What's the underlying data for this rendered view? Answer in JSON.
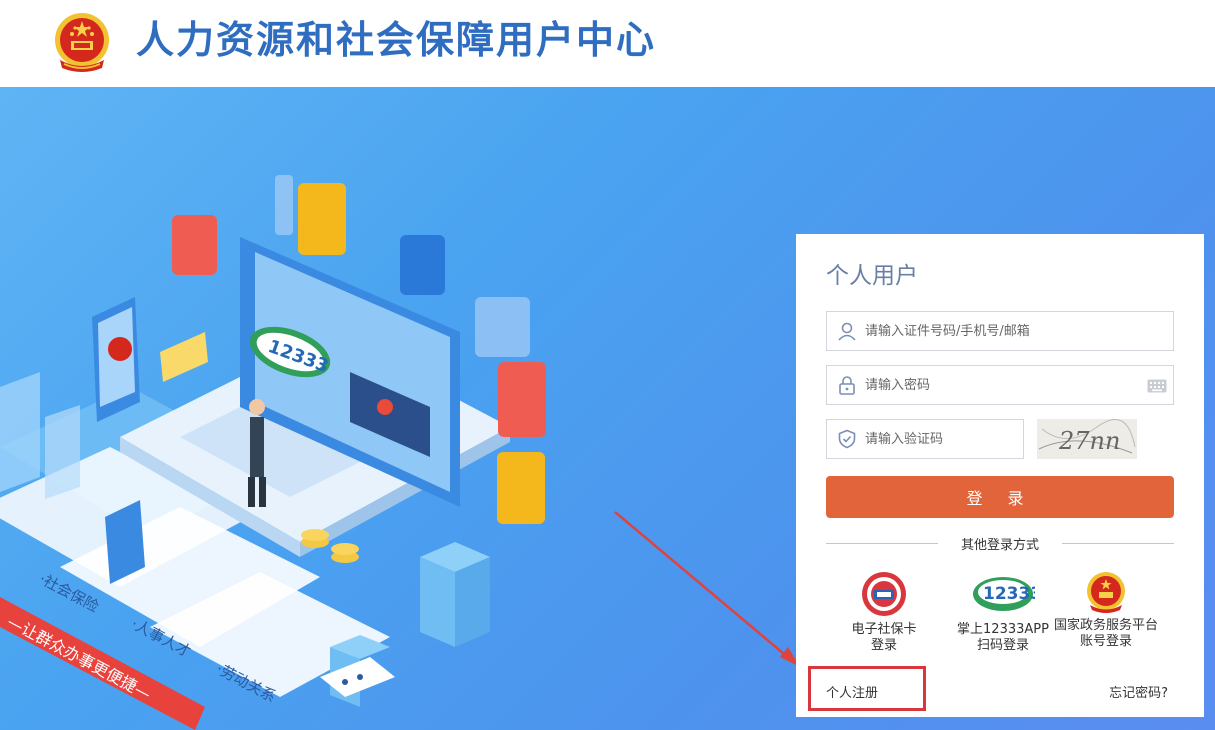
{
  "header": {
    "site_title": "人力资源和社会保障用户中心",
    "emblem_icon": "national-emblem-icon"
  },
  "illustration": {
    "hotline_badge": "12333",
    "card_label": "电子社保卡",
    "slogan": "—让群众办事更便捷—",
    "tiles": [
      "·社会保险",
      "·人事人才",
      "·劳动关系"
    ]
  },
  "login": {
    "title": "个人用户",
    "account_placeholder": "请输入证件号码/手机号/邮箱",
    "password_placeholder": "请输入密码",
    "captcha_placeholder": "请输入验证码",
    "captcha_text": "27nn",
    "login_button": "登  录",
    "other_methods_label": "其他登录方式",
    "methods": [
      {
        "line1": "电子社保卡",
        "line2": "登录",
        "icon": "social-security-card-icon"
      },
      {
        "line1": "掌上12333APP",
        "line2": "扫码登录",
        "icon": "12333-app-icon"
      },
      {
        "line1": "国家政务服务平台",
        "line2": "账号登录",
        "icon": "national-emblem-icon"
      }
    ],
    "register_link": "个人注册",
    "forgot_link": "忘记密码?"
  },
  "colors": {
    "accent_blue": "#2f6dc1",
    "login_button": "#e2643a",
    "annotation_red": "#d8383d",
    "hero_blue": "#4d9bf0"
  }
}
